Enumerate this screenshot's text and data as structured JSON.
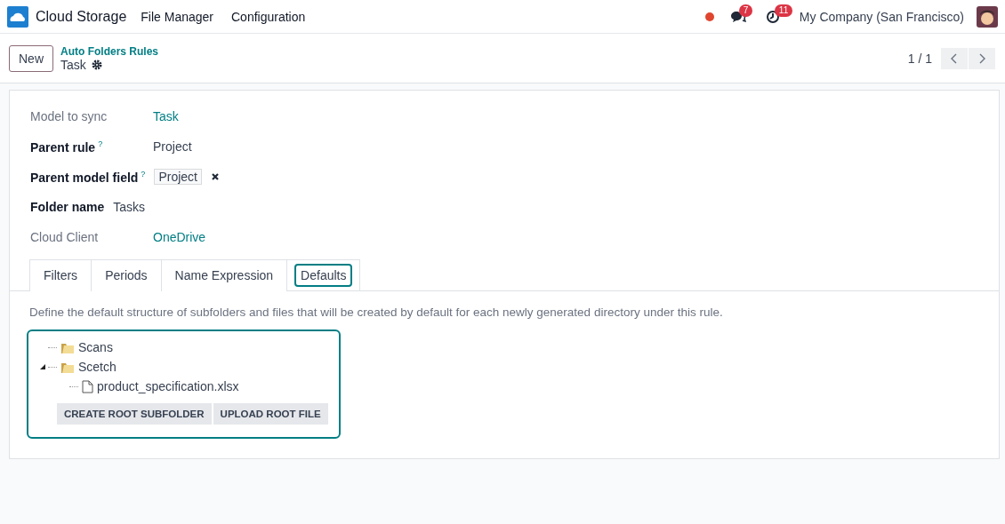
{
  "navbar": {
    "app_name": "Cloud Storage",
    "menus": [
      "File Manager",
      "Configuration"
    ],
    "status_dot": {
      "color": "#e0462f"
    },
    "messages_badge": "7",
    "activities_badge": "11",
    "company": "My Company (San Francisco)"
  },
  "control_panel": {
    "new_button": "New",
    "breadcrumb": "Auto Folders Rules",
    "record": "Task",
    "pager": "1 / 1"
  },
  "fields": [
    {
      "label": "Model to sync",
      "emphasized": false,
      "value": "Task",
      "kind": "link"
    },
    {
      "label": "Parent rule",
      "emphasized": true,
      "help": "?",
      "value": "Project",
      "kind": "text"
    },
    {
      "label": "Parent model field",
      "emphasized": true,
      "help": "?",
      "value": "Project",
      "kind": "tag"
    },
    {
      "label": "Folder name",
      "emphasized": true,
      "value": "Tasks",
      "kind": "text"
    },
    {
      "label": "Cloud Client",
      "emphasized": false,
      "value": "OneDrive",
      "kind": "link"
    }
  ],
  "tabs": [
    {
      "label": "Filters",
      "selected": false
    },
    {
      "label": "Periods",
      "selected": false
    },
    {
      "label": "Name Expression",
      "selected": false
    },
    {
      "label": "Defaults",
      "selected": true
    }
  ],
  "description": "Define the default structure of subfolders and files that will be created by default for each newly generated directory under this rule.",
  "tree": [
    {
      "label": "Scans",
      "kind": "folder",
      "expanded": false
    },
    {
      "label": "Scetch",
      "kind": "folder",
      "expanded": true,
      "children": [
        {
          "label": "product_specification.xlsx",
          "kind": "file"
        }
      ]
    }
  ],
  "tree_buttons": [
    "CREATE ROOT SUBFOLDER",
    "UPLOAD ROOT FILE"
  ]
}
